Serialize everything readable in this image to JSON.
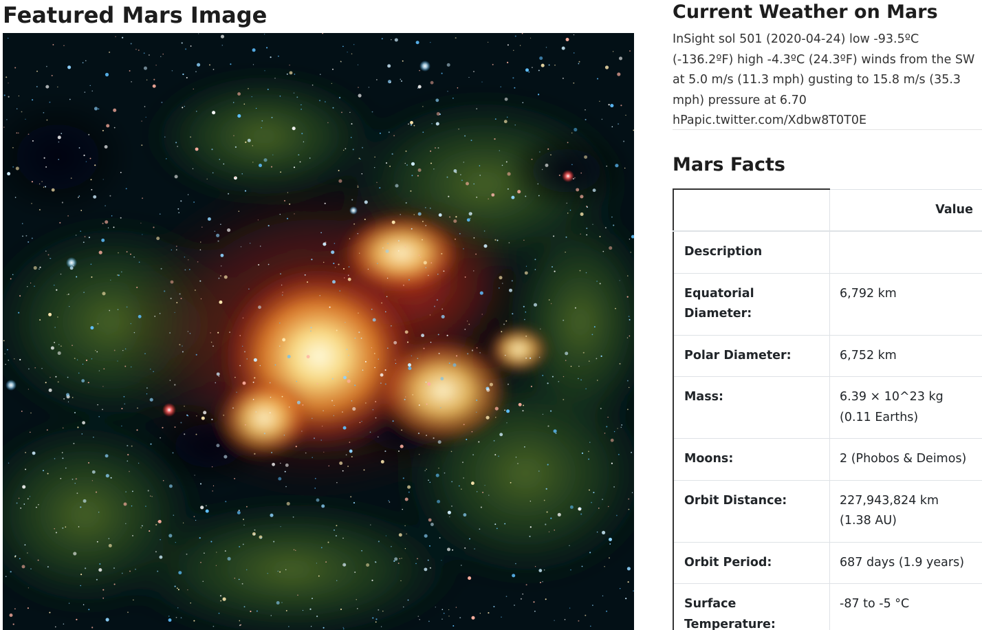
{
  "featured": {
    "title": "Featured Mars Image",
    "image_description": "space-nebula-image"
  },
  "weather": {
    "title": "Current Weather on Mars",
    "text": "InSight sol 501 (2020-04-24) low -93.5ºC (-136.2ºF) high -4.3ºC (24.3ºF) winds from the SW at 5.0 m/s (11.3 mph) gusting to 15.8 m/s (35.3 mph) pressure at 6.70 hPapic.twitter.com/Xdbw8T0T0E"
  },
  "facts": {
    "title": "Mars Facts",
    "header": {
      "label": "",
      "value": "Value"
    },
    "rows": [
      {
        "label": "Description",
        "value": ""
      },
      {
        "label": "Equatorial Diameter:",
        "value": "6,792 km"
      },
      {
        "label": "Polar Diameter:",
        "value": "6,752 km"
      },
      {
        "label": "Mass:",
        "value": "6.39 × 10^23 kg (0.11 Earths)"
      },
      {
        "label": "Moons:",
        "value": "2 (Phobos & Deimos)"
      },
      {
        "label": "Orbit Distance:",
        "value": "227,943,824 km (1.38 AU)"
      },
      {
        "label": "Orbit Period:",
        "value": "687 days (1.9 years)"
      },
      {
        "label": "Surface Temperature:",
        "value": "-87 to -5 °C"
      }
    ]
  }
}
